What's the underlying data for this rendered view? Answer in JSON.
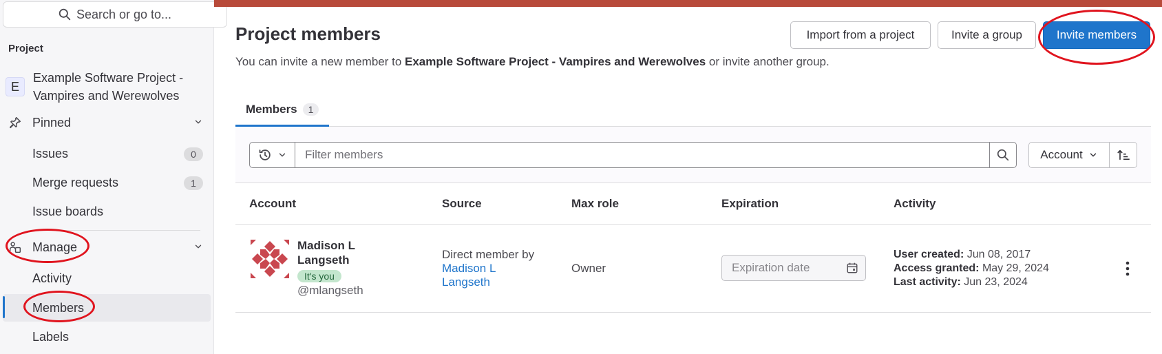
{
  "sidebar": {
    "search_placeholder": "Search or go to...",
    "section_title": "Project",
    "project_avatar_letter": "E",
    "project_name_line1": "Example Software Project -",
    "project_name_line2": "Vampires and Werewolves",
    "pinned_label": "Pinned",
    "pinned_items": [
      {
        "label": "Issues",
        "count": "0"
      },
      {
        "label": "Merge requests",
        "count": "1"
      },
      {
        "label": "Issue boards"
      }
    ],
    "manage_label": "Manage",
    "manage_items": [
      {
        "label": "Activity"
      },
      {
        "label": "Members"
      },
      {
        "label": "Labels"
      }
    ]
  },
  "header": {
    "title": "Project members",
    "subtitle_prefix": "You can invite a new member to ",
    "subtitle_project": "Example Software Project - Vampires and Werewolves",
    "subtitle_suffix": " or invite another group.",
    "import_button": "Import from a project",
    "invite_group_button": "Invite a group",
    "invite_members_button": "Invite members"
  },
  "tabs": [
    {
      "label": "Members",
      "count": "1"
    }
  ],
  "filter": {
    "placeholder": "Filter members",
    "sort_label": "Account"
  },
  "table": {
    "columns": [
      "Account",
      "Source",
      "Max role",
      "Expiration",
      "Activity"
    ],
    "rows": [
      {
        "name_line1": "Madison L",
        "name_line2": "Langseth",
        "you_badge": "It's you",
        "username": "@mlangseth",
        "source_prefix": "Direct member by",
        "source_link_line1": "Madison L",
        "source_link_line2": "Langseth",
        "max_role": "Owner",
        "expiration_placeholder": "Expiration date",
        "user_created_label": "User created:",
        "user_created_value": " Jun 08, 2017",
        "access_granted_label": "Access granted:",
        "access_granted_value": " May 29, 2024",
        "last_activity_label": "Last activity:",
        "last_activity_value": " Jun 23, 2024"
      }
    ]
  },
  "colors": {
    "primary": "#1f75cb",
    "topbar": "#b84a3a",
    "annotation": "#e0141e"
  }
}
